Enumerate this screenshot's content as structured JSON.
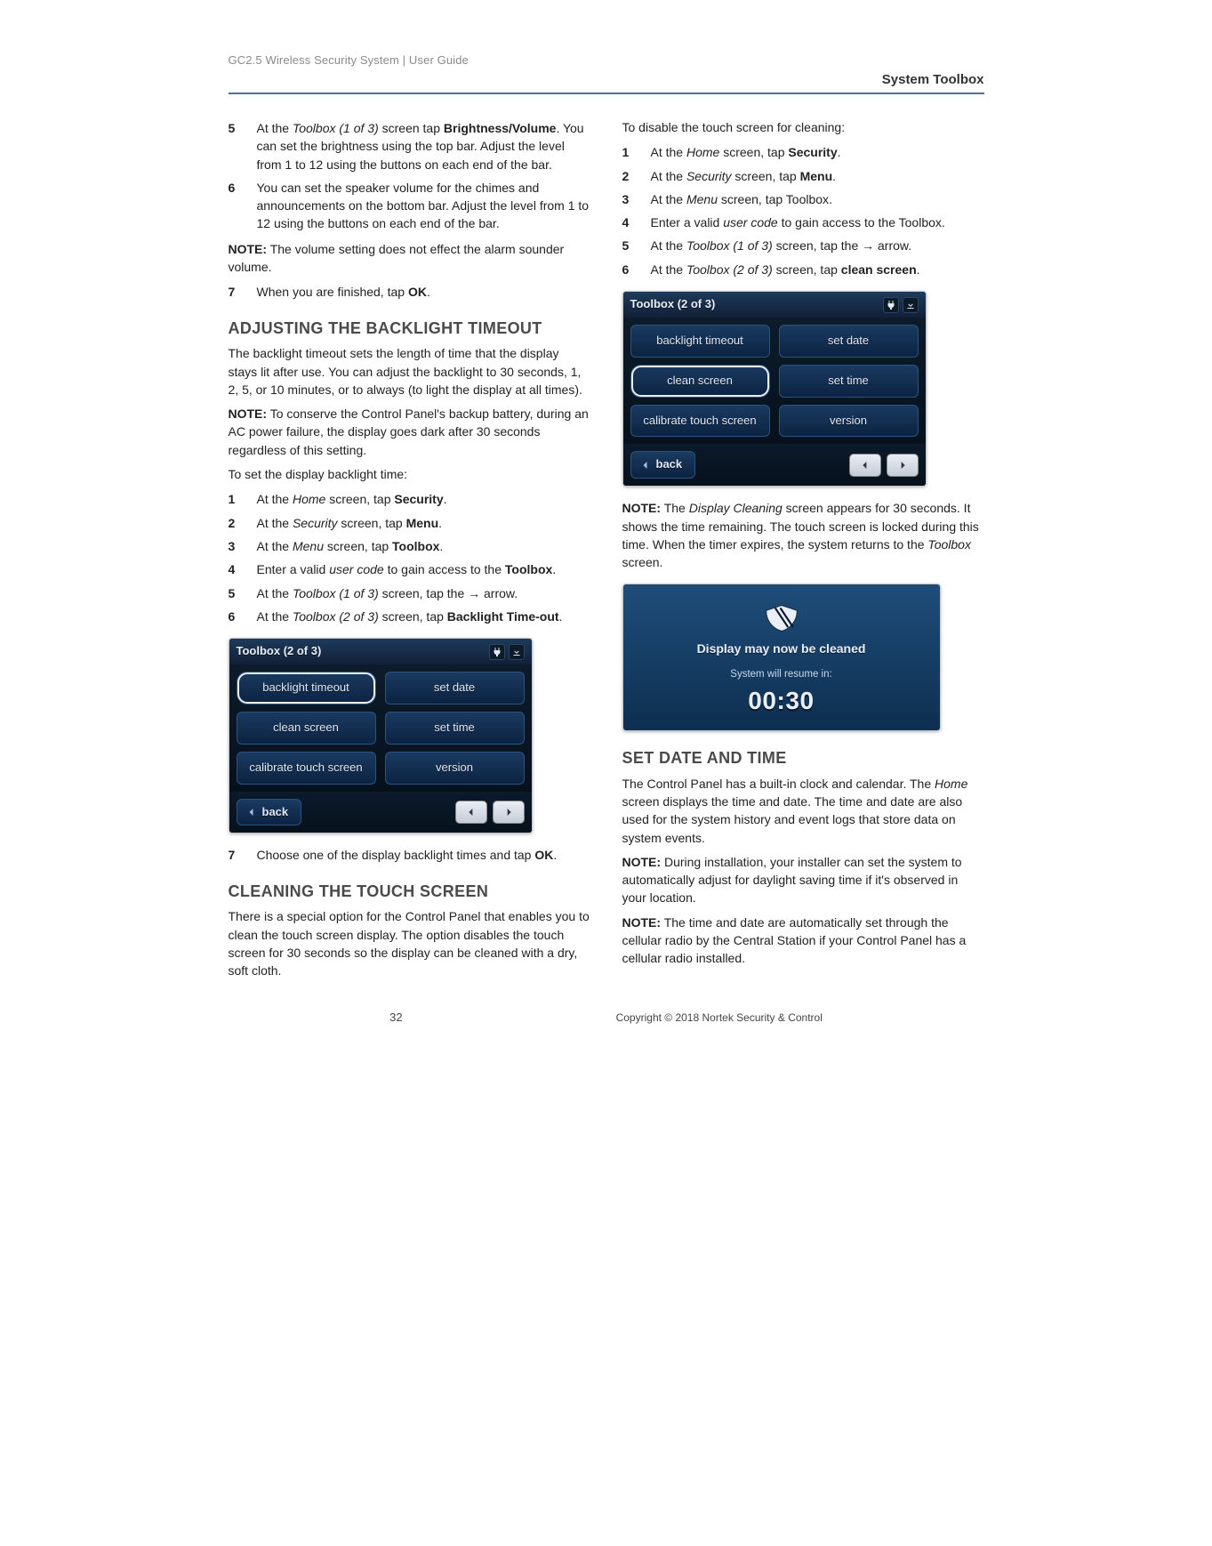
{
  "doc_header": "GC2.5 Wireless Security System | User Guide",
  "section_header": "System Toolbox",
  "col1": {
    "steps_a": [
      {
        "n": "5",
        "html": "At the <em>Toolbox (1 of 3)</em> screen tap <strong>Brightness/Volume</strong>. You can set the brightness using the top bar. Adjust the level from 1 to 12 using the buttons on each end of the bar."
      },
      {
        "n": "6",
        "html": "You can set the speaker volume for the chimes and announcements on the bottom bar. Adjust the level from 1 to 12 using the buttons on each end of the bar."
      }
    ],
    "note_a": "<strong>NOTE:</strong> The volume setting does not effect the alarm sounder volume.",
    "steps_b": [
      {
        "n": "7",
        "html": "When you are finished, tap <strong>OK</strong>."
      }
    ],
    "h_adjust": "ADJUSTING THE BACKLIGHT TIMEOUT",
    "adjust_intro": "The backlight timeout sets the length of time that the display stays lit after use. You can adjust the backlight to 30 seconds, 1, 2, 5, or 10 minutes, or to always (to light the display at all times).",
    "adjust_note": "<strong>NOTE:</strong> To conserve the Control Panel's backup battery, during an AC power failure, the display goes dark after 30 seconds regardless of this setting.",
    "adjust_lead": "To set the display backlight time:",
    "adjust_steps": [
      {
        "n": "1",
        "html": "At the <em>Home</em> screen, tap <strong>Security</strong>."
      },
      {
        "n": "2",
        "html": "At the <em>Security</em> screen, tap <strong>Menu</strong>."
      },
      {
        "n": "3",
        "html": "At the <em>Menu</em> screen, tap <strong>Toolbox</strong>."
      },
      {
        "n": "4",
        "html": "Enter a valid <em>user code</em> to gain access to the <strong>Toolbox</strong>."
      },
      {
        "n": "5",
        "html": "At the <em>Toolbox (1 of 3)</em> screen, tap the → arrow."
      },
      {
        "n": "6",
        "html": "At the <em>Toolbox (2 of 3)</em> screen, tap <strong>Backlight Time-out</strong>."
      }
    ],
    "adjust_after": [
      {
        "n": "7",
        "html": "Choose one of the display backlight times and tap <strong>OK</strong>."
      }
    ],
    "h_clean": "CLEANING THE TOUCH SCREEN",
    "clean_intro": "There is a special option for the Control Panel that enables you to clean the touch screen display. The option disables the touch screen for 30 seconds so the display can be cleaned with a dry, soft cloth."
  },
  "col2": {
    "clean_lead": "To disable the touch screen for cleaning:",
    "clean_steps": [
      {
        "n": "1",
        "html": "At the <em>Home</em> screen, tap <strong>Security</strong>."
      },
      {
        "n": "2",
        "html": "At the <em>Security</em> screen, tap <strong>Menu</strong>."
      },
      {
        "n": "3",
        "html": "At the <em>Menu</em> screen, tap Toolbox."
      },
      {
        "n": "4",
        "html": "Enter a valid <em>user code</em> to gain access to the Toolbox."
      },
      {
        "n": "5",
        "html": "At the <em>Toolbox (1 of 3)</em> screen, tap the → arrow."
      },
      {
        "n": "6",
        "html": "At the <em>Toolbox (2 of 3)</em> screen, tap <strong>clean screen</strong>."
      }
    ],
    "clean_note": "<strong>NOTE:</strong> The <em>Display Cleaning</em> screen appears for 30 seconds. It shows the time remaining. The touch screen is locked during this time. When the timer expires, the system returns to the <em>Toolbox</em> screen.",
    "h_date": "SET DATE AND TIME",
    "date_intro": "The Control Panel has a built-in clock and calendar. The <em>Home</em> screen displays the time and date. The time and date are also used for the system history and event logs that store data on system events.",
    "date_note1": "<strong>NOTE:</strong> During installation, your installer can set the system to automatically adjust for daylight saving time if it's observed in your location.",
    "date_note2": "<strong>NOTE:</strong> The time and date are automatically set through the cellular radio by the Central Station if your Control Panel has a cellular radio installed."
  },
  "device": {
    "title": "Toolbox (2 of 3)",
    "buttons_left": [
      "backlight timeout",
      "clean screen",
      "calibrate touch screen"
    ],
    "buttons_right": [
      "set date",
      "set time",
      "version"
    ],
    "back": "back"
  },
  "clean_device": {
    "line1": "Display may now be cleaned",
    "line2": "System will resume in:",
    "timer": "00:30"
  },
  "footer": {
    "page_number": "32",
    "copyright": "Copyright ©  2018 Nortek Security & Control"
  }
}
